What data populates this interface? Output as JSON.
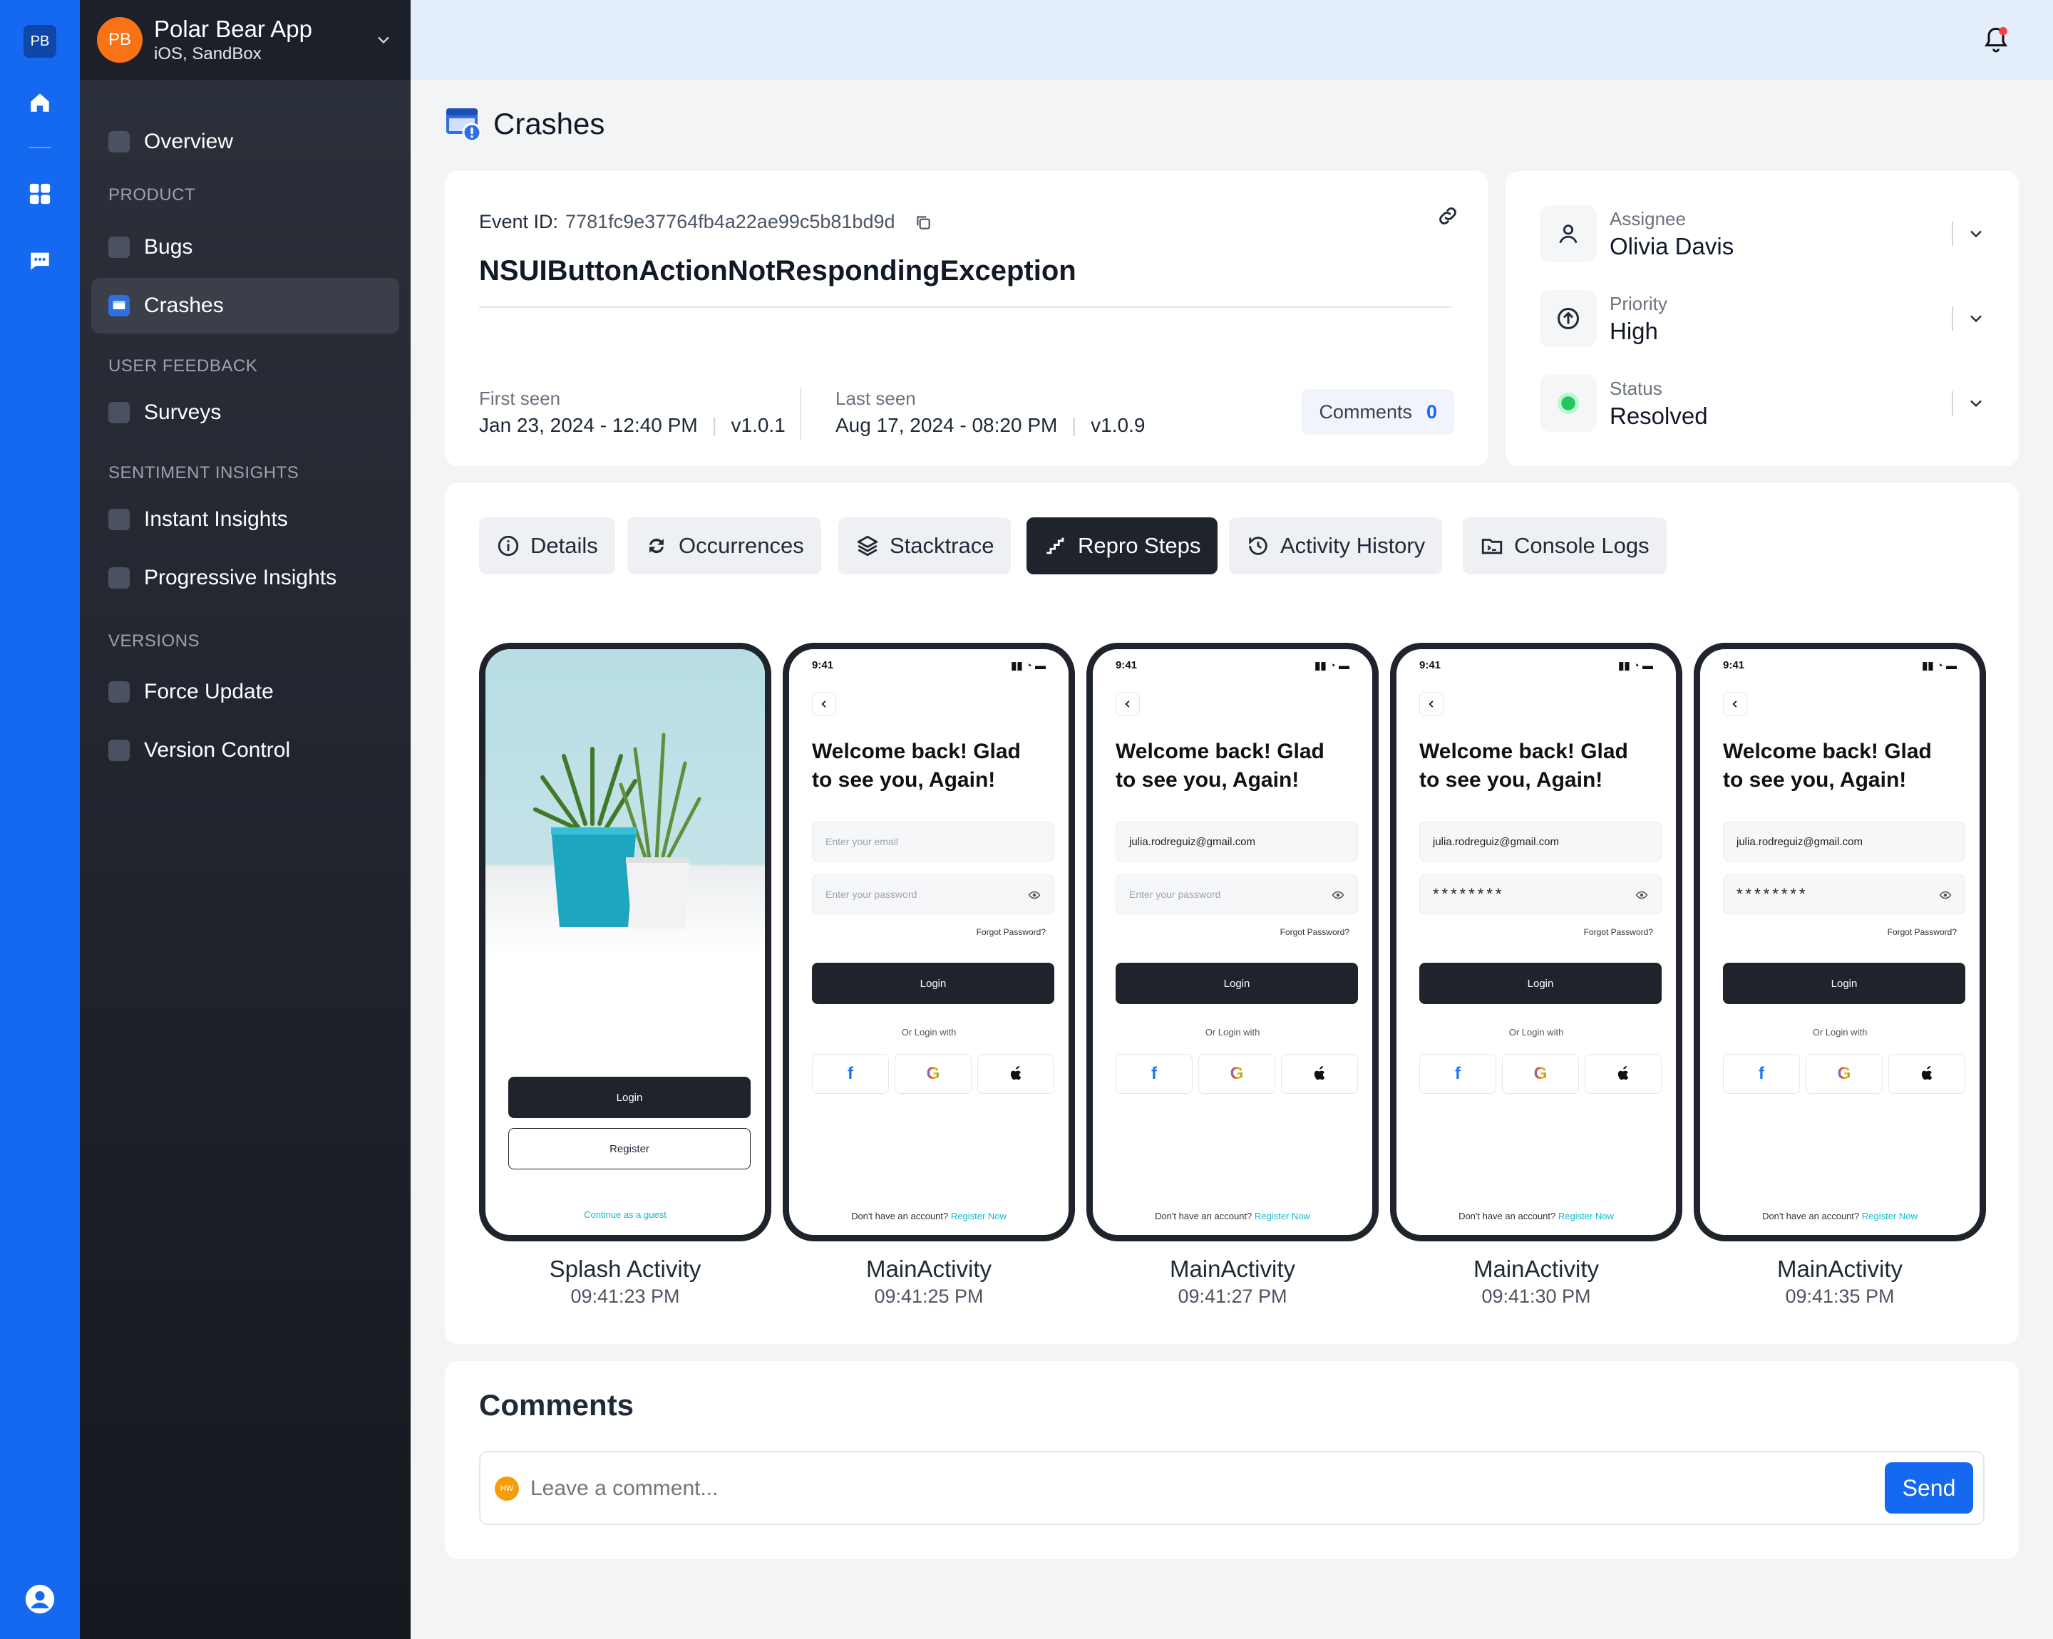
{
  "rail": {
    "logo": "PB",
    "icons": [
      "home-icon",
      "grid-icon",
      "chat-icon",
      "user-circle-icon"
    ]
  },
  "app": {
    "avatar": "PB",
    "name": "Polar Bear App",
    "subtitle": "iOS, SandBox"
  },
  "nav": {
    "overview": "Overview",
    "product_section": "PRODUCT",
    "bugs": "Bugs",
    "crashes": "Crashes",
    "feedback_section": "USER FEEDBACK",
    "surveys": "Surveys",
    "sentiment_section": "SENTIMENT INSIGHTS",
    "instant": "Instant Insights",
    "progressive": "Progressive Insights",
    "versions_section": "VERSIONS",
    "force_update": "Force Update",
    "version_control": "Version Control"
  },
  "page": {
    "title": "Crashes"
  },
  "event": {
    "id_label": "Event ID:",
    "id_value": "7781fc9e37764fb4a22ae99c5b81bd9d",
    "name": "NSUIButtonActionNotRespondingException",
    "first_seen_label": "First seen",
    "first_seen_value": "Jan 23, 2024 - 12:40 PM",
    "first_version": "v1.0.1",
    "last_seen_label": "Last seen",
    "last_seen_value": "Aug 17, 2024 - 08:20 PM",
    "last_version": "v1.0.9",
    "comments_label": "Comments",
    "comments_count": "0"
  },
  "meta": {
    "assignee_label": "Assignee",
    "assignee_value": "Olivia Davis",
    "priority_label": "Priority",
    "priority_value": "High",
    "status_label": "Status",
    "status_value": "Resolved",
    "status_color": "#22c55e"
  },
  "tabs": [
    "Details",
    "Occurrences",
    "Stacktrace",
    "Repro Steps",
    "Activity History",
    "Console Logs"
  ],
  "active_tab": "Repro Steps",
  "login": {
    "time": "9:41",
    "welcome_1": "Welcome back! Glad",
    "welcome_2": "to see you, Again!",
    "email_placeholder": "Enter your email",
    "password_placeholder": "Enter your password",
    "email_value": "julia.rodreguiz@gmail.com",
    "password_mask": "********",
    "forgot": "Forgot Password?",
    "login": "Login",
    "or_login": "Or Login with",
    "no_account": "Don't have an account?",
    "register_now": "Register Now",
    "register": "Register",
    "guest": "Continue as a guest"
  },
  "steps": [
    {
      "name": "Splash Activity",
      "time": "09:41:23 PM"
    },
    {
      "name": "MainActivity",
      "time": "09:41:25 PM"
    },
    {
      "name": "MainActivity",
      "time": "09:41:27 PM"
    },
    {
      "name": "MainActivity",
      "time": "09:41:30 PM"
    },
    {
      "name": "MainActivity",
      "time": "09:41:35 PM"
    }
  ],
  "comments": {
    "title": "Comments",
    "avatar": "HW",
    "placeholder": "Leave a comment...",
    "send": "Send"
  },
  "colors": {
    "brand": "#1469f0",
    "sidebar": "#23272f",
    "accent_link": "#14b8c7",
    "notification_dot": "#ef4444"
  }
}
